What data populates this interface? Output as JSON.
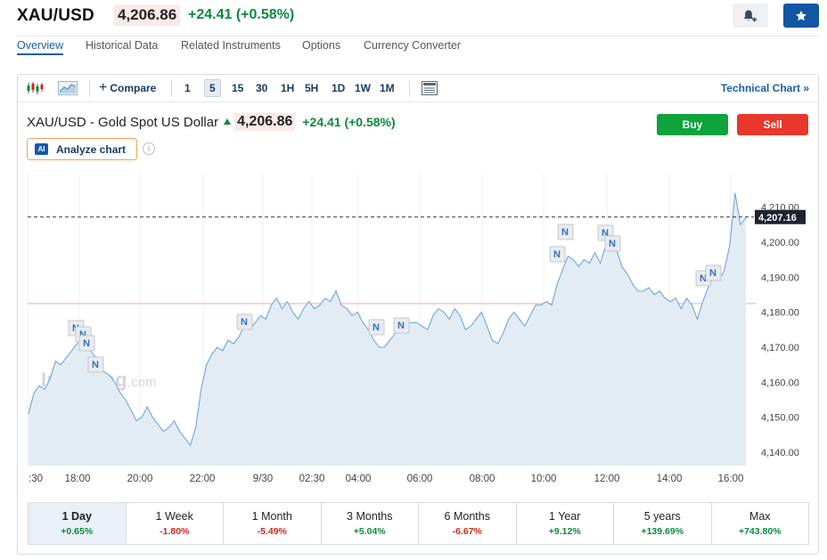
{
  "header": {
    "symbol": "XAU/USD",
    "price": "4,206.86",
    "change": "+24.41 (+0.58%)"
  },
  "tabs": [
    {
      "label": "Overview",
      "active": true
    },
    {
      "label": "Historical Data"
    },
    {
      "label": "Related Instruments"
    },
    {
      "label": "Options"
    },
    {
      "label": "Currency Converter"
    }
  ],
  "toolbar": {
    "compare_label": "Compare",
    "timeframes": [
      "1",
      "5",
      "15",
      "30",
      "1H",
      "5H",
      "1D",
      "1W",
      "1M"
    ],
    "active_timeframe": "5",
    "technical_chart_label": "Technical Chart »"
  },
  "chart": {
    "title": "XAU/USD - Gold Spot US Dollar",
    "price": "4,206.86",
    "change": "+24.41 (+0.58%)",
    "buy_label": "Buy",
    "sell_label": "Sell",
    "analyze_label": "Analyze chart",
    "ai_badge": "AI",
    "info_icon_text": "i",
    "watermark": "Investing",
    "watermark_suffix": ".com",
    "news_marker_text": "N"
  },
  "chart_data": {
    "type": "area",
    "x_tick_labels": [
      ":30",
      "18:00",
      "20:00",
      "22:00",
      "9/30",
      "02:30",
      "04:00",
      "06:00",
      "08:00",
      "10:00",
      "12:00",
      "14:00",
      "16:00"
    ],
    "y_tick_labels": [
      "4,210.00",
      "4,200.00",
      "4,190.00",
      "4,180.00",
      "4,170.00",
      "4,160.00",
      "4,150.00",
      "4,140.00"
    ],
    "y_ticks": [
      4210,
      4200,
      4190,
      4180,
      4170,
      4160,
      4150,
      4140
    ],
    "ylim": [
      4136.2,
      4219.3
    ],
    "last_price_label": "4,207.16",
    "last_price": 4207.16,
    "reference_price": 4182.45,
    "values": [
      4151,
      4157,
      4159,
      4158,
      4161,
      4166,
      4165,
      4167,
      4169,
      4171,
      4174,
      4170,
      4168,
      4166,
      4163,
      4162,
      4160,
      4157,
      4155,
      4152,
      4149,
      4150,
      4153,
      4150,
      4148,
      4146,
      4147,
      4149,
      4146,
      4144,
      4142,
      4147,
      4158,
      4165,
      4168,
      4170,
      4169,
      4172,
      4171,
      4173,
      4176,
      4175,
      4177,
      4179,
      4178,
      4182,
      4184,
      4181,
      4183,
      4180,
      4178,
      4181,
      4183,
      4181,
      4182,
      4184,
      4183,
      4186,
      4182,
      4181,
      4179,
      4180,
      4177,
      4175,
      4172,
      4170,
      4170,
      4172,
      4174,
      4176,
      4177,
      4177,
      4177,
      4176,
      4175,
      4179,
      4181,
      4180,
      4178,
      4181,
      4179,
      4175,
      4176,
      4178,
      4180,
      4176,
      4172,
      4171,
      4174,
      4178,
      4180,
      4178,
      4176,
      4179,
      4182,
      4182,
      4183,
      4182,
      4188,
      4192,
      4196,
      4195,
      4193,
      4195,
      4194,
      4197,
      4194,
      4199,
      4202,
      4198,
      4193,
      4191,
      4188,
      4186,
      4186,
      4187,
      4185,
      4186,
      4184,
      4183,
      4184,
      4181,
      4184,
      4182,
      4178,
      4183,
      4187,
      4190,
      4189,
      4192,
      4199,
      4214,
      4205,
      4207
    ]
  },
  "periods": [
    {
      "label": "1 Day",
      "value": "+0.65%",
      "positive": true,
      "active": true
    },
    {
      "label": "1 Week",
      "value": "-1.80%",
      "positive": false
    },
    {
      "label": "1 Month",
      "value": "-5.49%",
      "positive": false
    },
    {
      "label": "3 Months",
      "value": "+5.04%",
      "positive": true
    },
    {
      "label": "6 Months",
      "value": "-6.67%",
      "positive": false
    },
    {
      "label": "1 Year",
      "value": "+9.12%",
      "positive": true
    },
    {
      "label": "5 years",
      "value": "+139.69%",
      "positive": true
    },
    {
      "label": "Max",
      "value": "+743.80%",
      "positive": true
    }
  ],
  "colors": {
    "positive": "#0a8a3e",
    "negative": "#d3261a",
    "brand_blue": "#1256a4",
    "line": "#6fa6d6",
    "area": "#e3ecf5",
    "buy": "#0ea33b",
    "sell": "#e8372c"
  }
}
